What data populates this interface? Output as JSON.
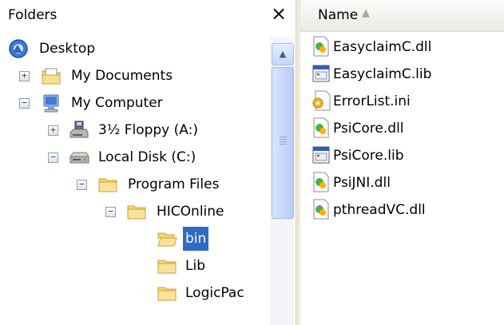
{
  "folders_pane": {
    "title": "Folders",
    "close_label": "×"
  },
  "tree": [
    {
      "label": "Desktop",
      "icon": "desktop-icon",
      "expander": ""
    },
    {
      "label": "My Documents",
      "icon": "my-documents-icon",
      "expander": "+"
    },
    {
      "label": "My Computer",
      "icon": "my-computer-icon",
      "expander": "−"
    },
    {
      "label": "3½ Floppy (A:)",
      "icon": "floppy-drive-icon",
      "expander": "+"
    },
    {
      "label": "Local Disk (C:)",
      "icon": "hard-disk-icon",
      "expander": "−"
    },
    {
      "label": "Program Files",
      "icon": "folder-icon",
      "expander": "−"
    },
    {
      "label": "HICOnline",
      "icon": "folder-icon",
      "expander": "−"
    },
    {
      "label": "bin",
      "icon": "folder-open-icon",
      "expander": "",
      "selected": true
    },
    {
      "label": "Lib",
      "icon": "folder-icon",
      "expander": ""
    },
    {
      "label": "LogicPac",
      "icon": "folder-icon",
      "expander": ""
    }
  ],
  "scrollbar": {
    "up_arrow": "▲"
  },
  "files_pane": {
    "column_name": "Name",
    "sort_indicator": "▲",
    "sort_order": "ascending"
  },
  "files": [
    {
      "name": "EasyclaimC.dll",
      "icon": "dll-file-icon"
    },
    {
      "name": "EasyclaimC.lib",
      "icon": "lib-file-icon"
    },
    {
      "name": "ErrorList.ini",
      "icon": "ini-file-icon"
    },
    {
      "name": "PsiCore.dll",
      "icon": "dll-file-icon"
    },
    {
      "name": "PsiCore.lib",
      "icon": "lib-file-icon"
    },
    {
      "name": "PsiJNI.dll",
      "icon": "dll-file-icon"
    },
    {
      "name": "pthreadVC.dll",
      "icon": "dll-file-icon"
    }
  ],
  "colors": {
    "selection": "#316ac5",
    "folder": "#f5d67a"
  }
}
